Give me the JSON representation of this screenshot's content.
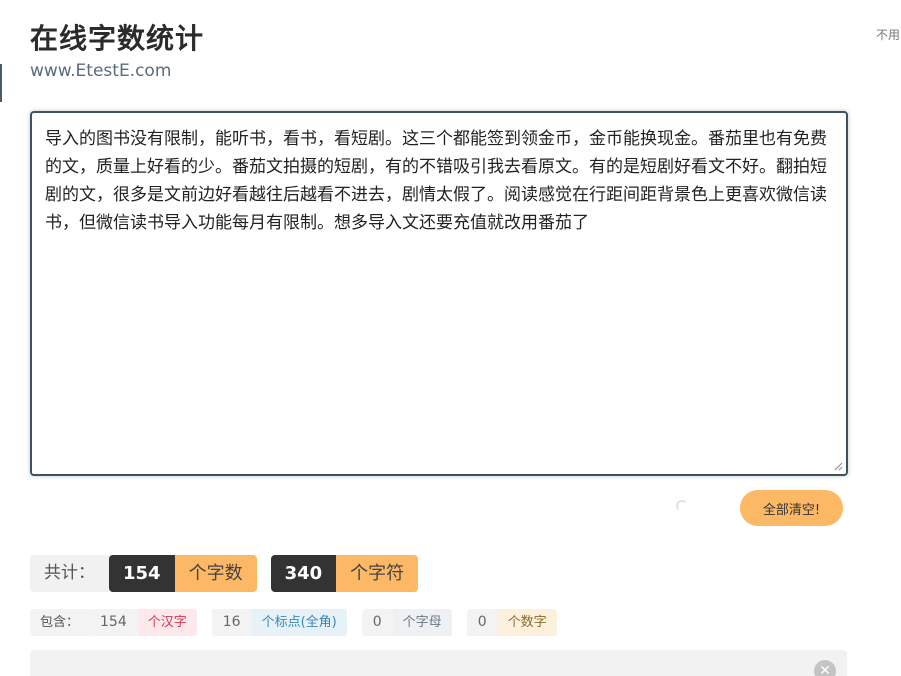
{
  "header": {
    "title": "在线字数统计",
    "url": "www.EtestE.com",
    "corner_text": "不用"
  },
  "editor": {
    "text": "导入的图书没有限制，能听书，看书，看短剧。这三个都能签到领金币，金币能换现金。番茄里也有免费的文，质量上好看的少。番茄文拍摄的短剧，有的不错吸引我去看原文。有的是短剧好看文不好。翻拍短剧的文，很多是文前边好看越往后越看不进去，剧情太假了。阅读感觉在行距间距背景色上更喜欢微信读书，但微信读书导入功能每月有限制。想多导入文还要充值就改用番茄了"
  },
  "actions": {
    "clear_label": "全部清空!"
  },
  "totals": {
    "label": "共计：",
    "words": {
      "value": "154",
      "unit": "个字数"
    },
    "chars": {
      "value": "340",
      "unit": "个字符"
    }
  },
  "details": {
    "label": "包含：",
    "hanzi": {
      "value": "154",
      "unit": "个汉字"
    },
    "punct": {
      "value": "16",
      "unit": "个标点(全角)"
    },
    "letters": {
      "value": "0",
      "unit": "个字母"
    },
    "digits": {
      "value": "0",
      "unit": "个数字"
    }
  },
  "colors": {
    "accent": "#fdb865",
    "dark": "#333333",
    "hanzi": "#d9354f",
    "punct": "#3a86b5"
  }
}
